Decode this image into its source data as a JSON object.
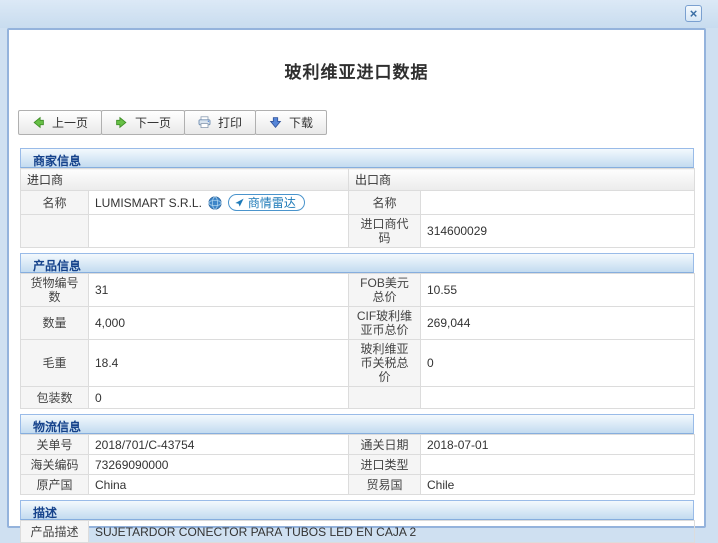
{
  "window": {
    "title": "玻利维亚进口数据",
    "close_icon": "×"
  },
  "toolbar": {
    "prev_label": "上一页",
    "next_label": "下一页",
    "print_label": "打印",
    "download_label": "下载"
  },
  "merchant": {
    "section_title": "商家信息",
    "importer_group_label": "进口商",
    "exporter_group_label": "出口商",
    "name_label": "名称",
    "importer_name": "LUMISMART S.R.L.",
    "radar_badge_label": "商情雷达",
    "exporter_name_label": "名称",
    "exporter_name": "",
    "importer_code_label": "进口商代码",
    "importer_code": "314600029",
    "empty_label": "",
    "empty_value": ""
  },
  "product": {
    "section_title": "产品信息",
    "rows": [
      {
        "label1": "货物编号数",
        "value1": "31",
        "label2": "FOB美元总价",
        "value2": "10.55"
      },
      {
        "label1": "数量",
        "value1": "4,000",
        "label2": "CIF玻利维亚币总价",
        "value2": "269,044"
      },
      {
        "label1": "毛重",
        "value1": "18.4",
        "label2": "玻利维亚币关税总价",
        "value2": "0"
      },
      {
        "label1": "包装数",
        "value1": "0",
        "label2": "",
        "value2": ""
      }
    ]
  },
  "logistics": {
    "section_title": "物流信息",
    "rows": [
      {
        "label1": "关单号",
        "value1": "2018/701/C-43754",
        "label2": "通关日期",
        "value2": "2018-07-01"
      },
      {
        "label1": "海关编码",
        "value1": "73269090000",
        "label2": "进口类型",
        "value2": ""
      },
      {
        "label1": "原产国",
        "value1": "China",
        "label2": "贸易国",
        "value2": "Chile"
      }
    ]
  },
  "description": {
    "section_title": "描述",
    "label": "产品描述",
    "value": "SUJETARDOR CONECTOR PARA TUBOS LED EN CAJA 2"
  },
  "icons": {
    "close": "close-icon",
    "prev": "arrow-left-icon",
    "next": "arrow-right-icon",
    "print": "printer-icon",
    "download": "arrow-down-icon",
    "globe": "globe-icon",
    "radar": "radar-pointer-icon"
  },
  "colors": {
    "accent_blue": "#15428b",
    "frame_blue": "#cfe0f1",
    "section_header_border": "#99bbe8",
    "green_arrow": "#67c046",
    "blue_arrow": "#5585d8",
    "badge_blue": "#1e7ab8"
  }
}
